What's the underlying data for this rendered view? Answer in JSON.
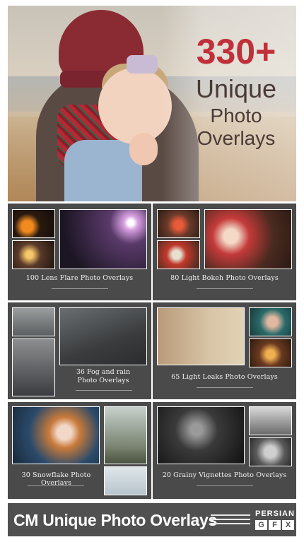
{
  "hero": {
    "count": "330+",
    "line1": "Unique",
    "line2": "Photo",
    "line3": "Overlays"
  },
  "cards": [
    {
      "caption": "100 Lens Flare Photo Overlays"
    },
    {
      "caption": "80 Light Bokeh Photo Overlays"
    },
    {
      "caption_line1": "36 Fog and rain",
      "caption_line2": "Photo Overlays"
    },
    {
      "caption": "65 Light Leaks Photo Overlays"
    },
    {
      "caption": "30 Snowflake Photo Overlays"
    },
    {
      "caption": "20 Grainy Vignettes Photo Overlays"
    }
  ],
  "footer": {
    "title": "CM Unique Photo Overlays",
    "logo_top": "PERSIAN",
    "logo_letters": [
      "G",
      "F",
      "X"
    ]
  }
}
